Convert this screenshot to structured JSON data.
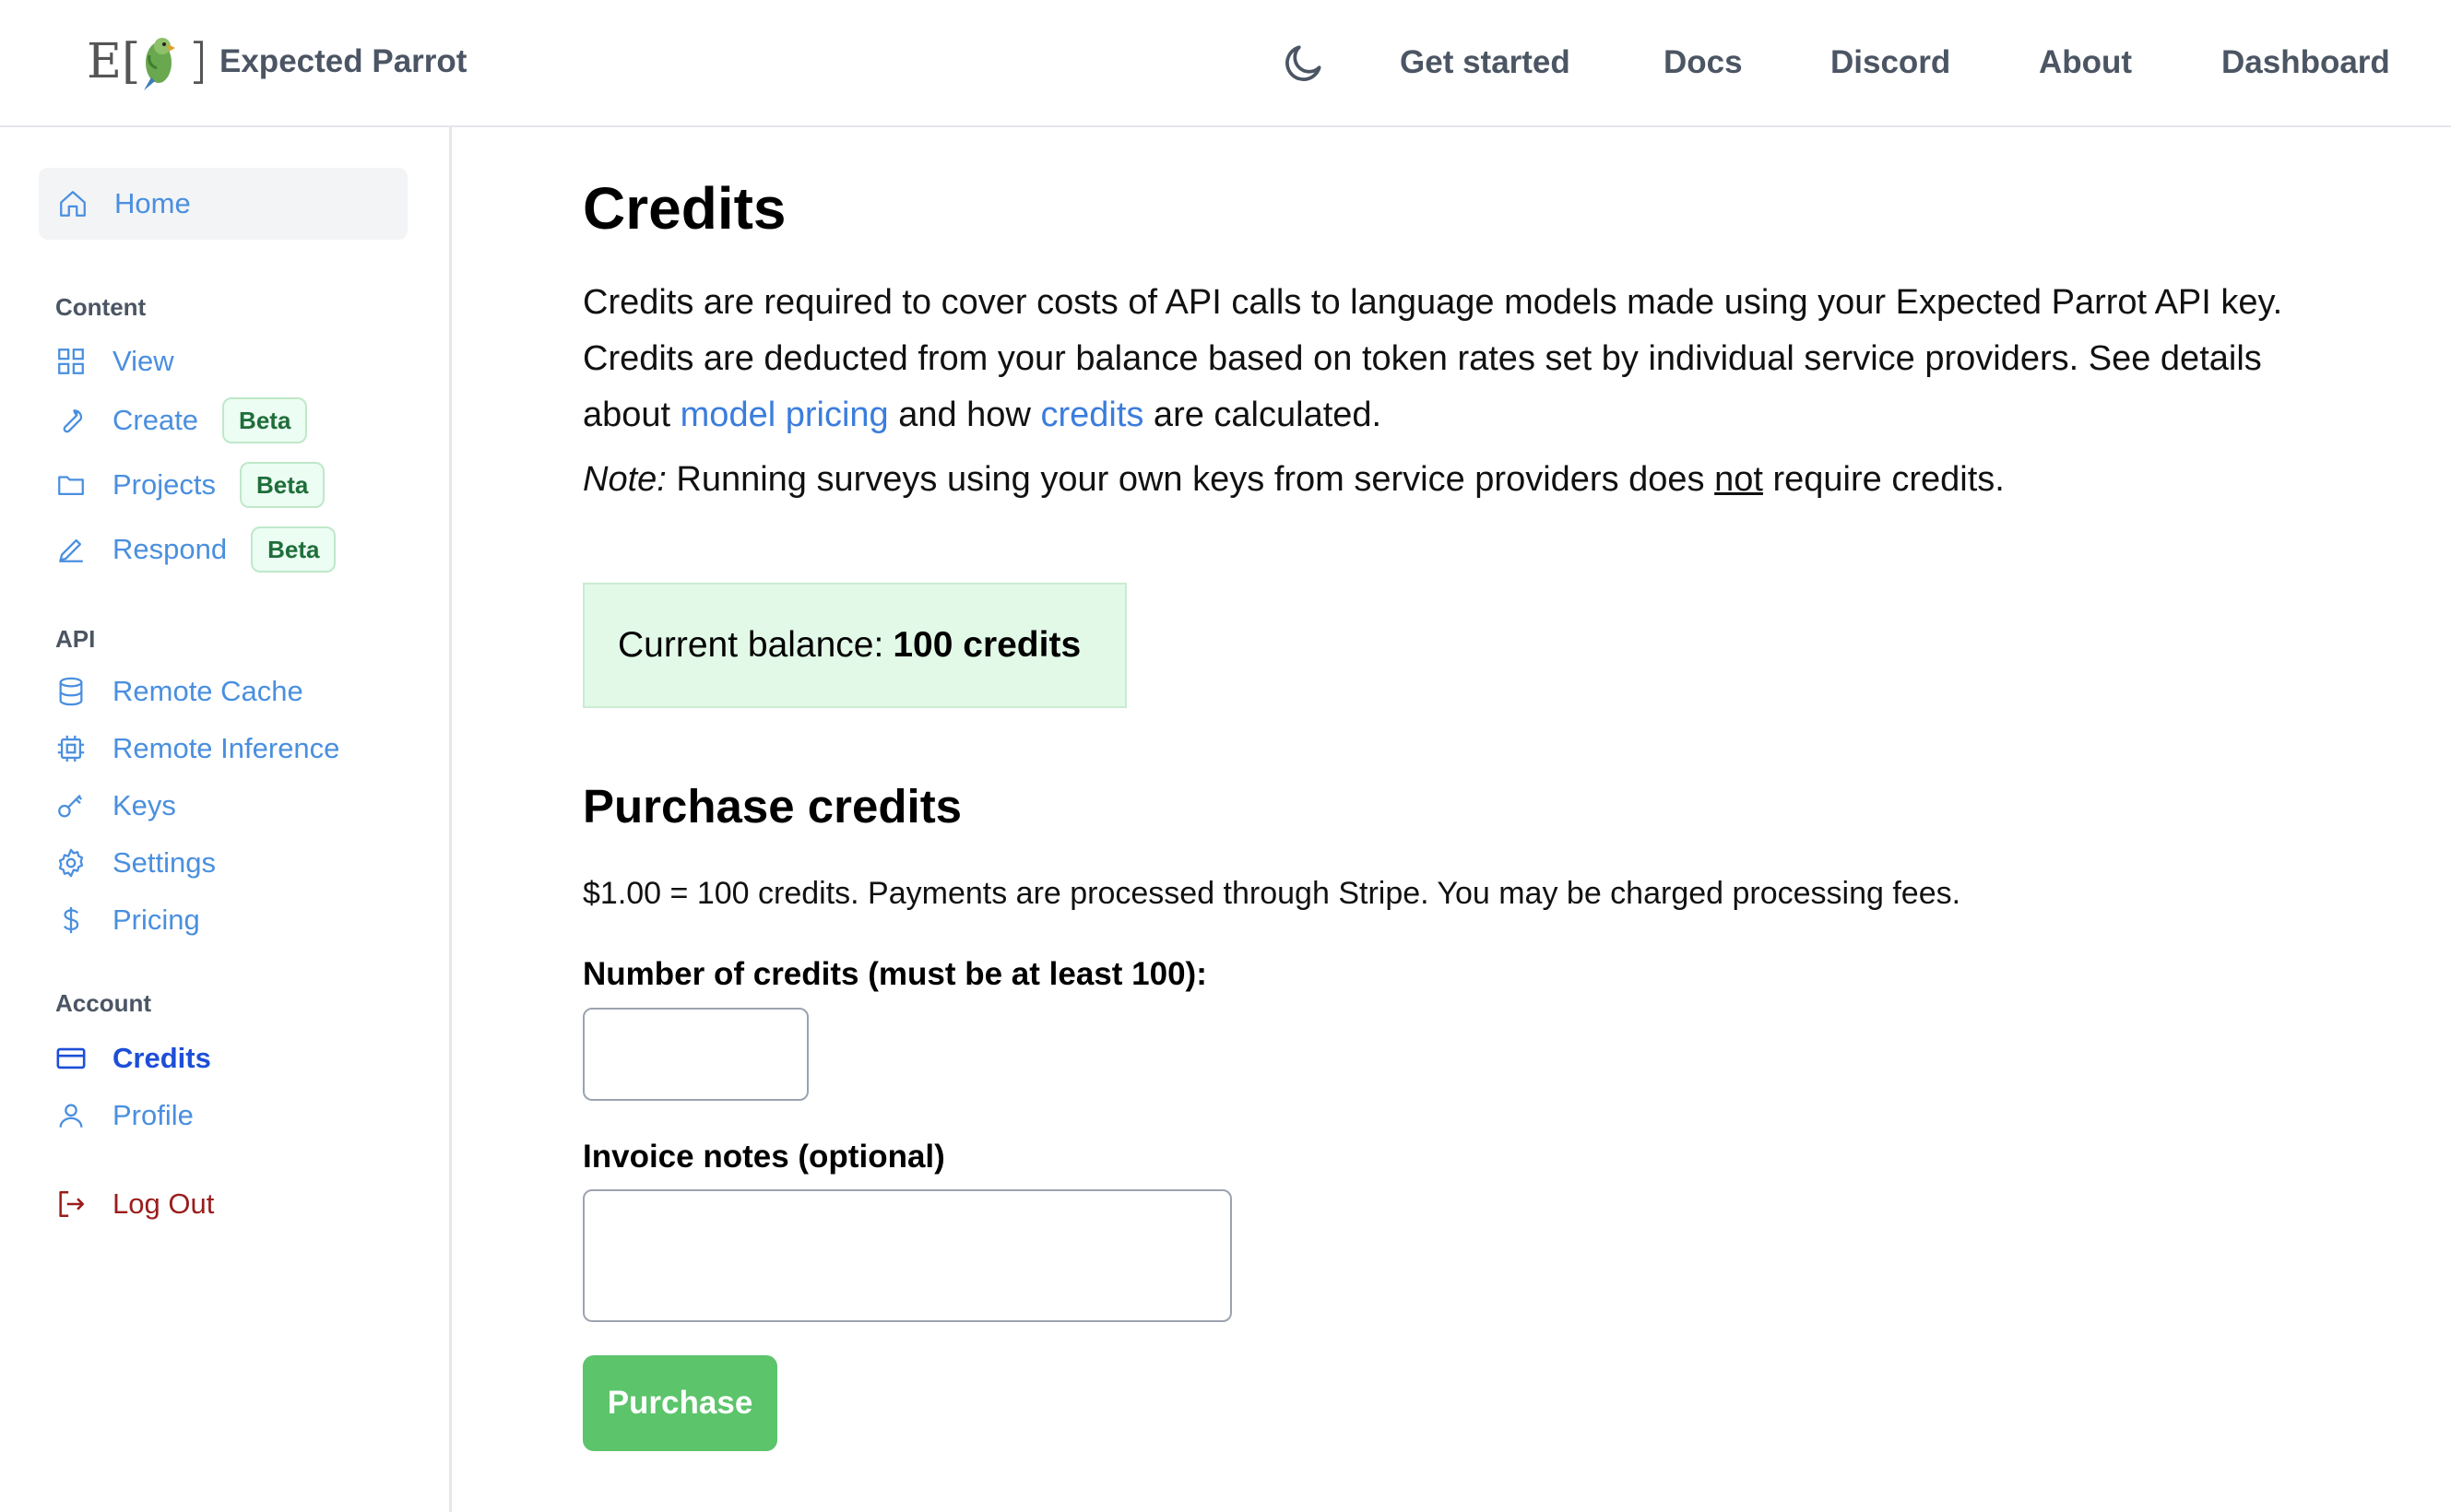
{
  "header": {
    "brand_name": "Expected Parrot",
    "logo_text": "E[",
    "logo_close": "]",
    "nav": [
      {
        "label": "Get started"
      },
      {
        "label": "Docs"
      },
      {
        "label": "Discord"
      },
      {
        "label": "About"
      },
      {
        "label": "Dashboard"
      }
    ],
    "theme_icon": "moon-icon"
  },
  "sidebar": {
    "home": {
      "label": "Home",
      "icon": "home-icon"
    },
    "sections": {
      "content": "Content",
      "api": "API",
      "account": "Account"
    },
    "content_items": [
      {
        "label": "View",
        "icon": "grid-icon"
      },
      {
        "label": "Create",
        "icon": "wrench-icon",
        "badge": "Beta"
      },
      {
        "label": "Projects",
        "icon": "folder-icon",
        "badge": "Beta"
      },
      {
        "label": "Respond",
        "icon": "pencil-icon",
        "badge": "Beta"
      }
    ],
    "api_items": [
      {
        "label": "Remote Cache",
        "icon": "database-icon"
      },
      {
        "label": "Remote Inference",
        "icon": "cpu-icon"
      },
      {
        "label": "Keys",
        "icon": "key-icon"
      },
      {
        "label": "Settings",
        "icon": "gear-icon"
      },
      {
        "label": "Pricing",
        "icon": "dollar-icon"
      }
    ],
    "account_items": [
      {
        "label": "Credits",
        "icon": "credit-card-icon",
        "active": true
      },
      {
        "label": "Profile",
        "icon": "user-icon"
      }
    ],
    "logout": {
      "label": "Log Out",
      "icon": "logout-icon"
    }
  },
  "main": {
    "title": "Credits",
    "intro_part1": "Credits are required to cover costs of API calls to language models made using your Expected Parrot API key. Credits are deducted from your balance based on token rates set by individual service providers. See details about ",
    "intro_link1": "model pricing",
    "intro_part2": " and how ",
    "intro_link2": "credits",
    "intro_part3": " are calculated.",
    "note_label": "Note:",
    "note_part1": " Running surveys using your own keys from service providers does ",
    "note_emph": "not",
    "note_part2": " require credits.",
    "balance_label": "Current balance:",
    "balance_value": "100 credits",
    "purchase_title": "Purchase credits",
    "rate_text": "$1.00 = 100 credits. Payments are processed through Stripe. You may be charged processing fees.",
    "credits_label": "Number of credits (must be at least 100):",
    "credits_value": "",
    "notes_label": "Invoice notes (optional)",
    "notes_value": "",
    "purchase_button": "Purchase"
  },
  "colors": {
    "link": "#4a8fdf",
    "active": "#1d4ed8",
    "logout": "#9b1c1c",
    "balance_bg": "#e3f9e8",
    "button": "#5cc46b"
  }
}
